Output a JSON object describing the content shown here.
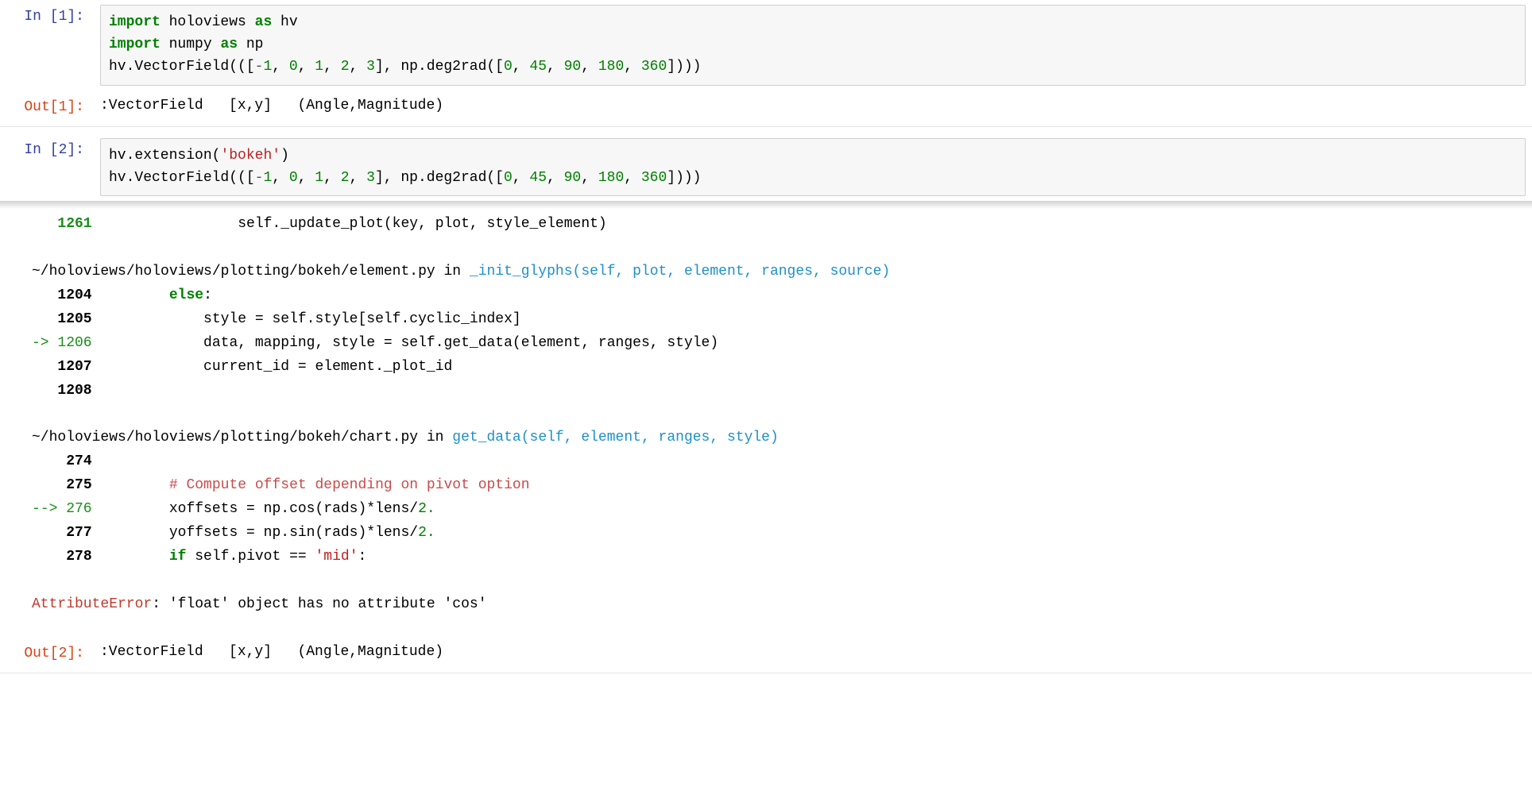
{
  "cells": {
    "c1": {
      "in_prompt": "In [1]:",
      "out_prompt": "Out[1]:",
      "code_html": "<span class=\"c-kw\">import</span> holoviews <span class=\"c-kw\">as</span> hv\n<span class=\"c-kw\">import</span> numpy <span class=\"c-kw\">as</span> np\nhv.VectorField(([<span class=\"c-op\">-</span><span class=\"c-num\">1</span>, <span class=\"c-num\">0</span>, <span class=\"c-num\">1</span>, <span class=\"c-num\">2</span>, <span class=\"c-num\">3</span>], np.deg2rad([<span class=\"c-num\">0</span>, <span class=\"c-num\">45</span>, <span class=\"c-num\">90</span>, <span class=\"c-num\">180</span>, <span class=\"c-num\">360</span>])))",
      "output": ":VectorField   [x,y]   (Angle,Magnitude)"
    },
    "c2": {
      "in_prompt": "In [2]:",
      "out_prompt": "Out[2]:",
      "code_html": "hv.extension(<span class=\"c-str\">'bokeh'</span>)\nhv.VectorField(([<span class=\"c-op\">-</span><span class=\"c-num\">1</span>, <span class=\"c-num\">0</span>, <span class=\"c-num\">1</span>, <span class=\"c-num\">2</span>, <span class=\"c-num\">3</span>], np.deg2rad([<span class=\"c-num\">0</span>, <span class=\"c-num\">45</span>, <span class=\"c-num\">90</span>, <span class=\"c-num\">180</span>, <span class=\"c-num\">360</span>])))",
      "output": ":VectorField   [x,y]   (Angle,Magnitude)"
    }
  },
  "traceback": {
    "cutoff_html": "   <span class=\"c-green c-bold\">1261</span>                 self._update_plot(key, plot, style_element)",
    "frame1_header_html": "~/holoviews/holoviews/plotting/bokeh/element.py in <span class=\"c-call\">_init_glyphs</span><span class=\"c-call\">(self, plot, element, ranges, source)</span>",
    "frame1_lines": [
      "   <span class=\"c-bold\">1204</span>         <span class=\"c-kw2\">else</span>:",
      "   <span class=\"c-bold\">1205</span>             style = self.style[self.cyclic_index]",
      "<span class=\"c-green\">-> 1206</span>             data, mapping, style = self.get_data(element, ranges, style)",
      "   <span class=\"c-bold\">1207</span>             current_id = element._plot_id",
      "   <span class=\"c-bold\">1208</span>"
    ],
    "frame2_header_html": "~/holoviews/holoviews/plotting/bokeh/chart.py in <span class=\"c-call\">get_data</span><span class=\"c-call\">(self, element, ranges, style)</span>",
    "frame2_lines": [
      "    <span class=\"c-bold\">274</span>",
      "    <span class=\"c-bold\">275</span>         <span class=\"c-comment\"># Compute offset depending on pivot option</span>",
      "<span class=\"c-green\">--> 276</span>         xoffsets = np.cos(rads)*lens/<span class=\"c-num\">2.</span>",
      "    <span class=\"c-bold\">277</span>         yoffsets = np.sin(rads)*lens/<span class=\"c-num\">2.</span>",
      "    <span class=\"c-bold\">278</span>         <span class=\"c-kw2\">if</span> self.pivot == <span class=\"c-str\">'mid'</span>:"
    ],
    "error_html": "<span class=\"c-err\">AttributeError</span>: 'float' object has no attribute 'cos'"
  }
}
